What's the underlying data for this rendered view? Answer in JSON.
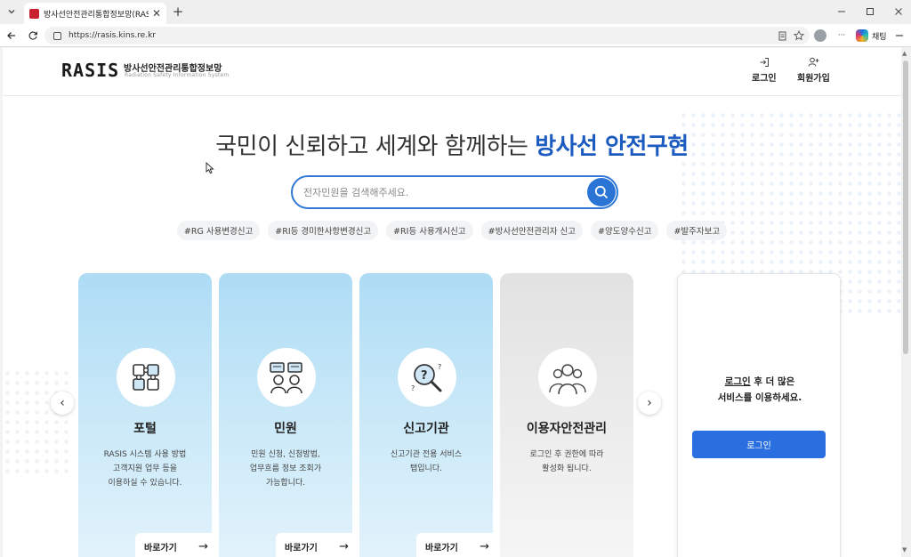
{
  "browser": {
    "tab_title": "방사선안전관리통합정보망(RASIS)",
    "url": "https://rasis.kins.re.kr",
    "copilot_label": "채팅",
    "tab_close": "✕",
    "new_tab": "+",
    "more": "···"
  },
  "header": {
    "logo_word": "RASIS",
    "logo_kr": "방사선안전관리통합정보망",
    "logo_en": "Radiation Safety Information System",
    "login_label": "로그인",
    "signup_label": "회원가입"
  },
  "hero": {
    "prefix": "국민이 신뢰하고 세계와 함께하는",
    "highlight": "방사선 안전구현"
  },
  "search": {
    "placeholder": "전자민원을 검색해주세요."
  },
  "tags": [
    "#RG 사용변경신고",
    "#RI등 경미한사항변경신고",
    "#RI등 사용개시신고",
    "#방사선안전관리자 신고",
    "#양도양수신고",
    "#발주자보고"
  ],
  "cards": [
    {
      "title": "포털",
      "desc": "RASIS 시스템 사용 방법\n고객지원 업무 등을\n이용하실 수 있습니다.",
      "goto": "바로가기",
      "icon": "puzzle-icon",
      "style": "blue"
    },
    {
      "title": "민원",
      "desc": "민원 신청, 신청방법,\n업무흐름 정보 조회가\n가능합니다.",
      "goto": "바로가기",
      "icon": "consultation-icon",
      "style": "blue"
    },
    {
      "title": "신고기관",
      "desc": "신고기관 전용 서비스\n탭입니다.",
      "goto": "바로가기",
      "icon": "magnifier-question-icon",
      "style": "blue"
    },
    {
      "title": "이용자안전관리",
      "desc": "로그인 후 권한에 따라\n활성화 됩니다.",
      "goto": "",
      "icon": "users-group-icon",
      "style": "gray"
    }
  ],
  "login_panel": {
    "link_text": "로그인",
    "msg_rest": " 후 더 많은",
    "msg_line2": "서비스를 이용하세요.",
    "button_label": "로그인"
  },
  "arrows": {
    "prev": "‹",
    "next": "›",
    "goto_arrow": "→"
  },
  "colors": {
    "brand_blue": "#1c5bbf",
    "search_blue": "#2a74d6",
    "login_blue": "#2a6fe0",
    "card_blue": "#aedcf5"
  }
}
